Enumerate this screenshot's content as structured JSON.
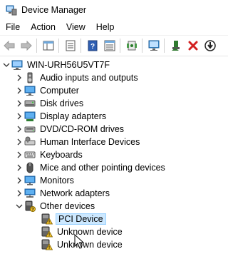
{
  "window": {
    "title": "Device Manager"
  },
  "menu": [
    "File",
    "Action",
    "View",
    "Help"
  ],
  "toolbar": {
    "buttons": [
      "back-icon",
      "forward-icon",
      "show-hide-tree-icon",
      "properties-icon",
      "help-icon",
      "devices-by-type-icon",
      "update-driver-icon",
      "scan-hardware-icon",
      "enable-device-icon",
      "uninstall-icon",
      "download-icon"
    ]
  },
  "tree": {
    "root": "WIN-URH56U5VT7F",
    "categories": [
      {
        "label": "Audio inputs and outputs",
        "icon": "speaker-icon"
      },
      {
        "label": "Computer",
        "icon": "computer-icon"
      },
      {
        "label": "Disk drives",
        "icon": "disk-drive-icon"
      },
      {
        "label": "Display adapters",
        "icon": "display-adapter-icon"
      },
      {
        "label": "DVD/CD-ROM drives",
        "icon": "dvd-drive-icon"
      },
      {
        "label": "Human Interface Devices",
        "icon": "hid-icon"
      },
      {
        "label": "Keyboards",
        "icon": "keyboard-icon"
      },
      {
        "label": "Mice and other pointing devices",
        "icon": "mouse-icon"
      },
      {
        "label": "Monitors",
        "icon": "monitor-icon"
      },
      {
        "label": "Network adapters",
        "icon": "network-adapter-icon"
      },
      {
        "label": "Other devices",
        "icon": "other-devices-icon",
        "expanded": true
      }
    ],
    "other_devices": [
      {
        "label": "PCI Device",
        "icon": "warning-device-icon",
        "selected": true
      },
      {
        "label": "Unknown device",
        "icon": "warning-device-icon"
      },
      {
        "label": "Unknown device",
        "icon": "warning-device-icon"
      }
    ]
  },
  "colors": {
    "selection_bg": "#cce8ff",
    "selection_border": "#99d1ff",
    "warning": "#f4c430"
  }
}
